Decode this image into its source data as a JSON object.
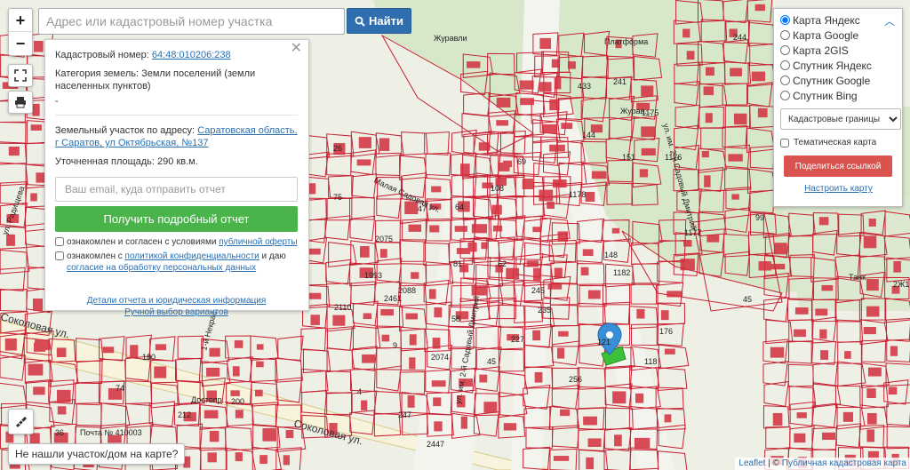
{
  "search": {
    "placeholder": "Адрес или кадастровый номер участка",
    "button": "Найти"
  },
  "zoom": {
    "in": "+",
    "out": "−"
  },
  "info": {
    "cadastral_label": "Кадастровый номер:",
    "cadastral_value": "64:48:010206:238",
    "category_label": "Категория земель:",
    "category_value": "Земли поселений (земли населенных пунктов)",
    "dash": "-",
    "address_label": "Земельный участок по адресу:",
    "address_value": "Саратовская область, г Саратов, ул Октябрьская, №137",
    "area_label": "Уточненная площадь:",
    "area_value": "290 кв.м.",
    "email_placeholder": "Ваш email, куда отправить отчет",
    "report_button": "Получить подробный отчет",
    "consent1_text": "ознакомлен и согласен с условиями ",
    "consent1_link": "публичной оферты",
    "consent2_text": "ознакомлен с ",
    "consent2_link": "политикой конфиденциальности",
    "consent2_tail": " и даю",
    "consent2_link2": "согласие на обработку персональных данных",
    "details_link": "Детали отчета и юридическая информация",
    "manual_link": "Ручной выбор вариантов"
  },
  "layers": {
    "options": [
      "Карта Яндекс",
      "Карта Google",
      "Карта 2GIS",
      "Спутник Яндекс",
      "Спутник Google",
      "Спутник Bing"
    ],
    "selected_index": 0,
    "select_value": "Кадастровые границы",
    "thematic_label": "Тематическая карта",
    "share_button": "Поделиться ссылкой",
    "setup_link": "Настроить карту"
  },
  "notfound": "Не нашли участок/дом на карте?",
  "attribution": {
    "leaflet": "Leaflet",
    "sep": " | © ",
    "pkk": "Публичная кадастровая карта"
  },
  "map_labels": {
    "streets": [
      "Соколовая ул.",
      "Соколовая ул.",
      "Малая Садовая ул.",
      "ул. им. 2-й Садовый Дмитрий",
      "ул. им. 2-й Садовый Дмитрий",
      "1-й Некрасовский",
      "ул. Радищева"
    ],
    "pois": [
      "Журавли",
      "Платформа",
      "Журав...",
      "Почта № 410003",
      "Танк",
      "Достопр..."
    ],
    "parcels": [
      "433",
      "241",
      "1175",
      "1176",
      "1177",
      "1178",
      "1182",
      "151",
      "99",
      "144",
      "244",
      "26",
      "75",
      "47",
      "69",
      "108",
      "81",
      "2075",
      "1993",
      "2088",
      "2110",
      "2461",
      "58",
      "227",
      "245",
      "118",
      "176",
      "45",
      "36",
      "74",
      "2447",
      "2074",
      "4",
      "9",
      "62",
      "64",
      "45",
      "148",
      "235",
      "121",
      "256",
      "247",
      "180",
      "212",
      "200",
      "2Ж1"
    ]
  },
  "colors": {
    "parcel": "#c82033",
    "building": "#d42f3f",
    "park": "#d6e8c9",
    "road": "#f5f5f0",
    "selected": "#3ec13a",
    "pin": "#3a8ed8"
  }
}
